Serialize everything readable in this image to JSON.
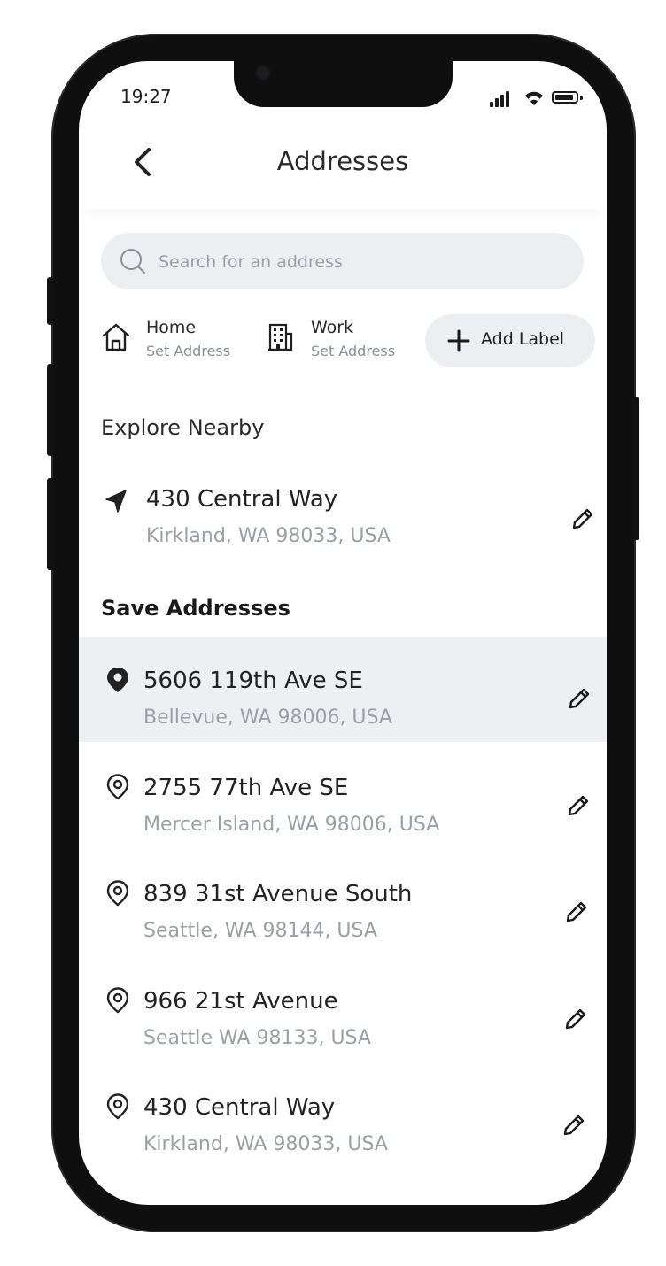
{
  "status_bar": {
    "time": "19:27"
  },
  "header": {
    "title": "Addresses",
    "back_icon": "chevron-left-icon"
  },
  "search": {
    "placeholder": "Search for an address",
    "value": ""
  },
  "labels": [
    {
      "name": "Home",
      "sub": "Set Address",
      "icon": "home-icon"
    },
    {
      "name": "Work",
      "sub": "Set Address",
      "icon": "building-icon"
    }
  ],
  "add_label": {
    "text": "Add Label",
    "icon": "plus-icon"
  },
  "explore": {
    "title": "Explore Nearby",
    "item": {
      "street": "430 Central Way",
      "city": "Kirkland, WA 98033, USA",
      "icon": "navigation-arrow-icon"
    }
  },
  "saved": {
    "title": "Save Addresses",
    "items": [
      {
        "street": "5606 119th Ave SE",
        "city": "Bellevue, WA 98006, USA",
        "selected": true
      },
      {
        "street": "2755 77th Ave SE",
        "city": "Mercer Island, WA 98006, USA",
        "selected": false
      },
      {
        "street": "839 31st Avenue South",
        "city": "Seattle, WA 98144, USA",
        "selected": false
      },
      {
        "street": "966 21st Avenue",
        "city": "Seattle WA 98133, USA",
        "selected": false
      },
      {
        "street": "430 Central Way",
        "city": "Kirkland, WA 98033, USA",
        "selected": false
      }
    ]
  },
  "colors": {
    "selected_row": "#edf0f3",
    "search_bg": "#eceff2",
    "muted_text": "#9aa0a6",
    "primary_text": "#222222"
  }
}
